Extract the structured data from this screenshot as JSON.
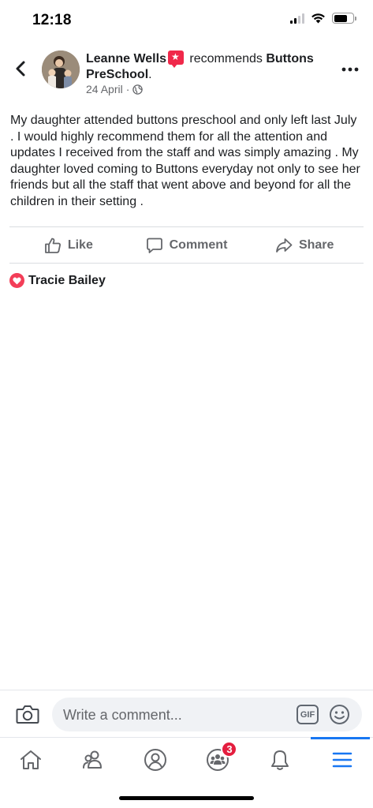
{
  "status_bar": {
    "time": "12:18"
  },
  "post": {
    "author": "Leanne Wells",
    "action_text": " recommends ",
    "page_name": "Buttons PreSchool",
    "date": "24 April",
    "body": "My daughter attended buttons preschool and only left last July . I would highly recommend them for all the attention and updates I received from the  staff and was simply amazing . My daughter loved coming to Buttons everyday not only to see her friends but all the staff that  went above and beyond for all the children in their setting ."
  },
  "actions": {
    "like": "Like",
    "comment": "Comment",
    "share": "Share"
  },
  "reactions": {
    "name": "Tracie Bailey",
    "icon": "heart-icon"
  },
  "composer": {
    "placeholder": "Write a comment...",
    "gif_label": "GIF"
  },
  "nav": {
    "groups_badge": "3",
    "items": [
      "home-icon",
      "friends-icon",
      "profile-icon",
      "groups-icon",
      "notifications-icon",
      "menu-icon"
    ]
  },
  "colors": {
    "accent": "#1877f2",
    "badge": "#e41e3f",
    "love": "#f33e58",
    "recommend": "#f0284a"
  }
}
